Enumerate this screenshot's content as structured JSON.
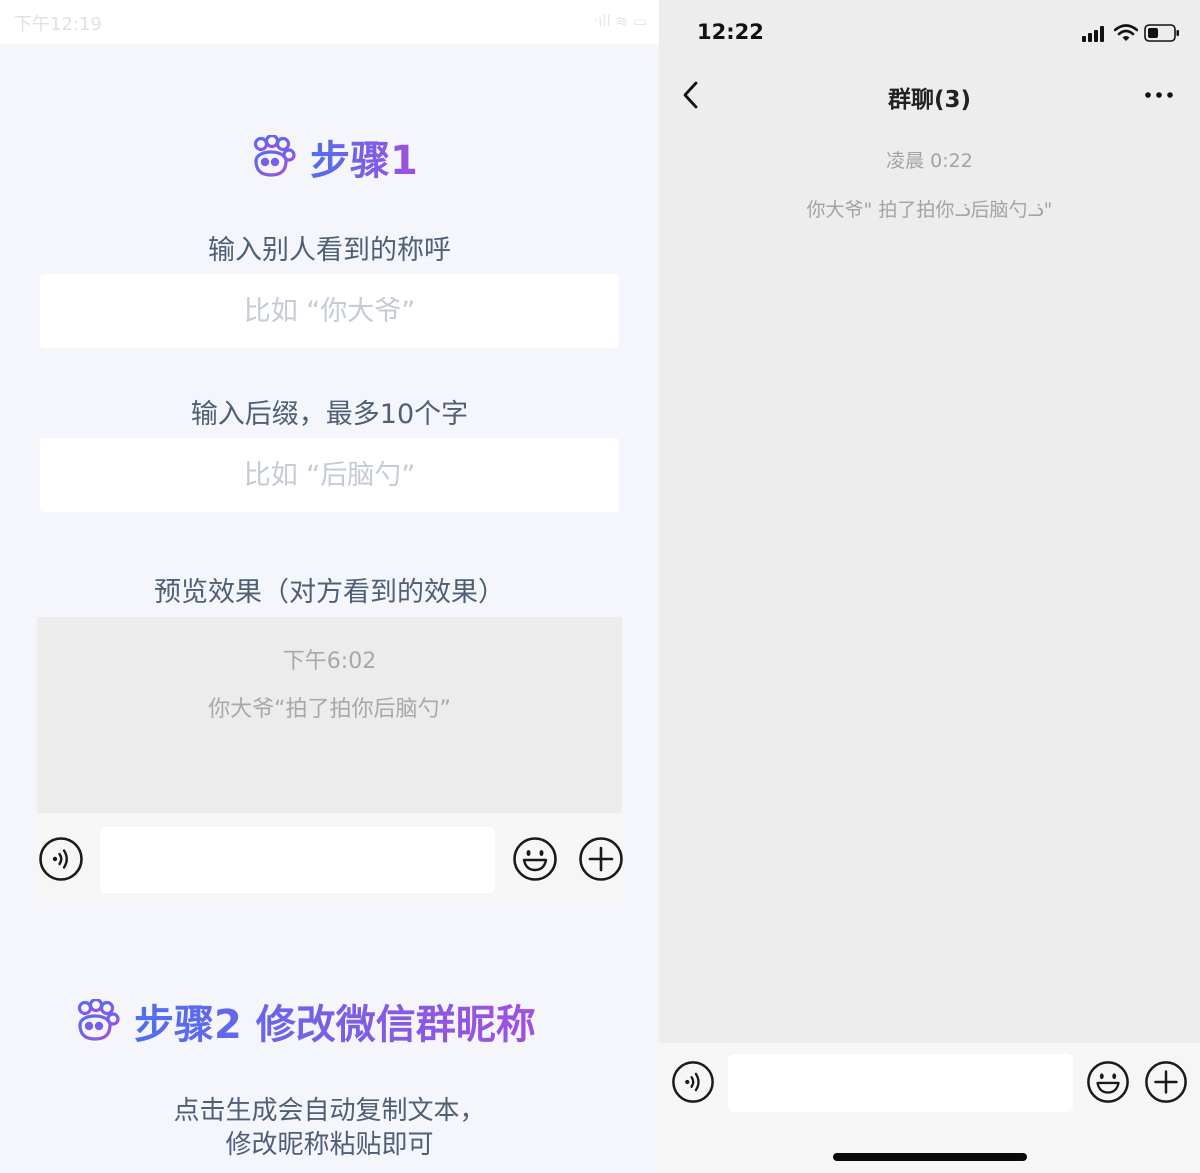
{
  "left_panel": {
    "status_bar": {
      "time": "下午12:19",
      "right_icons": "·ıll ≋ ▭"
    },
    "step1": {
      "title": "步骤1",
      "name_label": "输入别人看到的称呼",
      "name_placeholder": "比如 “你大爷”",
      "suffix_label": "输入后缀，最多10个字",
      "suffix_placeholder": "比如 “后脑勺”",
      "preview_label": "预览效果（对方看到的效果）",
      "preview": {
        "time": "下午6:02",
        "message": "你大爷“拍了拍你后脑勺”"
      }
    },
    "step2": {
      "title": "步骤2 修改微信群昵称",
      "instruction_line1": "点击生成会自动复制文本，",
      "instruction_line2": "修改昵称粘贴即可"
    }
  },
  "right_panel": {
    "status_bar": {
      "time": "12:22"
    },
    "header": {
      "title": "群聊(3)"
    },
    "chat": {
      "time": "凌晨 0:22",
      "message": "你大爷\" 拍了拍你ᓘ后脑勺ᓘ\""
    }
  },
  "colors": {
    "accent_purple": "#7b55e6",
    "accent_blue": "#4f6ff0",
    "label_text": "#4e5f76",
    "placeholder_text": "#c4cad6",
    "chat_bg": "#ededed"
  }
}
